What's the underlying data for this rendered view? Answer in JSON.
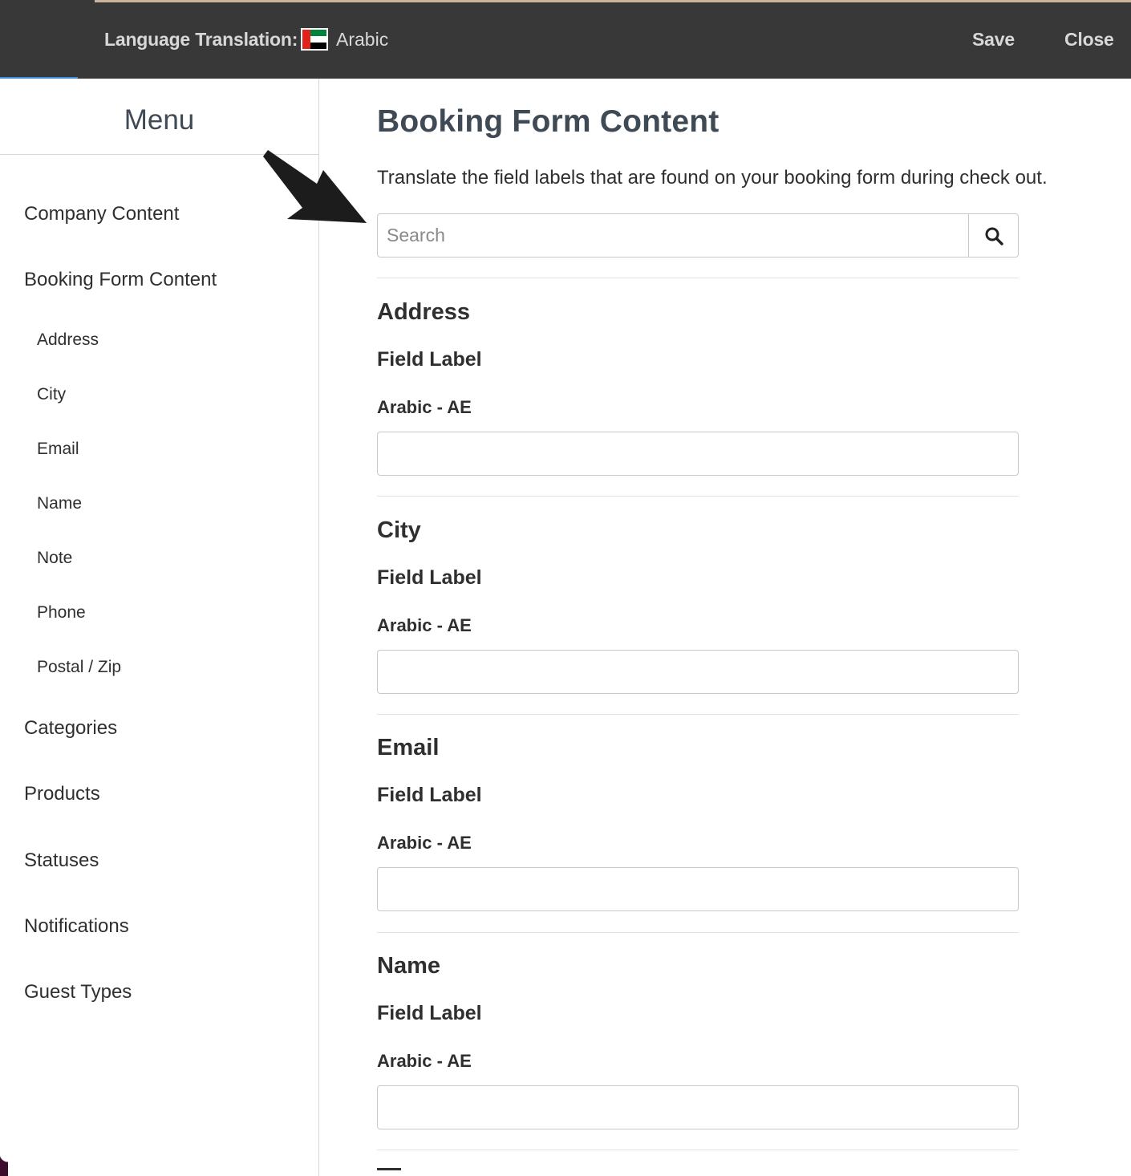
{
  "topbar": {
    "language_label": "Language Translation:",
    "language_value": "Arabic",
    "flag_icon": "uae-flag-icon",
    "save_label": "Save",
    "close_label": "Close",
    "bg_color": "#383838",
    "accent_color": "#c9b59b"
  },
  "sidebar": {
    "title": "Menu",
    "items": [
      {
        "label": "Company Content"
      },
      {
        "label": "Booking Form Content"
      },
      {
        "label": "Categories"
      },
      {
        "label": "Products"
      },
      {
        "label": "Statuses"
      },
      {
        "label": "Notifications"
      },
      {
        "label": "Guest Types"
      }
    ],
    "subitems": [
      {
        "label": "Address"
      },
      {
        "label": "City"
      },
      {
        "label": "Email"
      },
      {
        "label": "Name"
      },
      {
        "label": "Note"
      },
      {
        "label": "Phone"
      },
      {
        "label": "Postal / Zip"
      }
    ]
  },
  "main": {
    "title": "Booking Form Content",
    "description": "Translate the field labels that are found on your booking form during check out.",
    "search": {
      "placeholder": "Search",
      "value": "",
      "icon": "search-icon"
    },
    "sections": [
      {
        "title": "Address",
        "field_label": "Field Label",
        "lang_code": "Arabic - AE",
        "value": ""
      },
      {
        "title": "City",
        "field_label": "Field Label",
        "lang_code": "Arabic - AE",
        "value": ""
      },
      {
        "title": "Email",
        "field_label": "Field Label",
        "lang_code": "Arabic - AE",
        "value": ""
      },
      {
        "title": "Name",
        "field_label": "Field Label",
        "lang_code": "Arabic - AE",
        "value": ""
      }
    ]
  }
}
